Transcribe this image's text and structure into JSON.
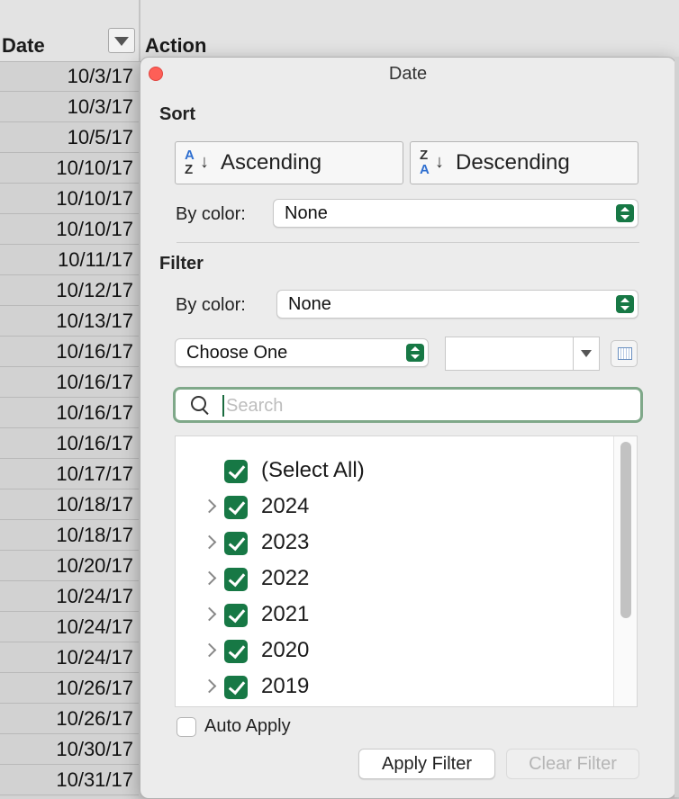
{
  "sheet": {
    "date_header": "Date",
    "action_header": "Action",
    "dates": [
      "10/3/17",
      "10/3/17",
      "10/5/17",
      "10/10/17",
      "10/10/17",
      "10/10/17",
      "10/11/17",
      "10/12/17",
      "10/13/17",
      "10/16/17",
      "10/16/17",
      "10/16/17",
      "10/16/17",
      "10/17/17",
      "10/18/17",
      "10/18/17",
      "10/20/17",
      "10/24/17",
      "10/24/17",
      "10/24/17",
      "10/26/17",
      "10/26/17",
      "10/30/17",
      "10/31/17"
    ]
  },
  "popup": {
    "title": "Date",
    "sort": {
      "title": "Sort",
      "ascending_label": "Ascending",
      "descending_label": "Descending",
      "by_color_label": "By color:",
      "by_color_value": "None"
    },
    "filter": {
      "title": "Filter",
      "by_color_label": "By color:",
      "by_color_value": "None",
      "condition_value": "Choose One",
      "search_placeholder": "Search",
      "items": [
        {
          "label": "(Select All)",
          "expandable": false,
          "checked": true
        },
        {
          "label": "2024",
          "expandable": true,
          "checked": true
        },
        {
          "label": "2023",
          "expandable": true,
          "checked": true
        },
        {
          "label": "2022",
          "expandable": true,
          "checked": true
        },
        {
          "label": "2021",
          "expandable": true,
          "checked": true
        },
        {
          "label": "2020",
          "expandable": true,
          "checked": true
        },
        {
          "label": "2019",
          "expandable": true,
          "checked": true
        }
      ],
      "auto_apply_label": "Auto Apply",
      "auto_apply_checked": false,
      "apply_button": "Apply Filter",
      "clear_button": "Clear Filter"
    }
  },
  "colors": {
    "accent_green": "#177845",
    "close_red": "#fe5f57",
    "search_focus": "#7fa889"
  }
}
